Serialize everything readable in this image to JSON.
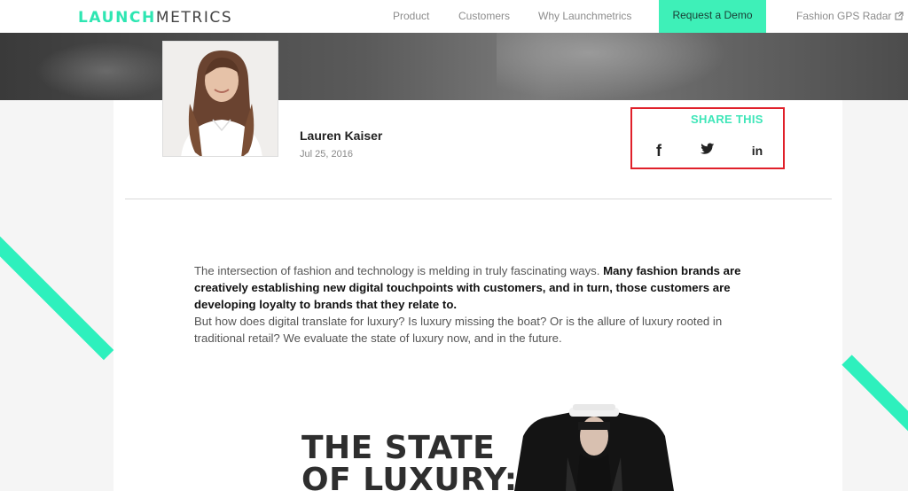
{
  "logo": {
    "text_main": "LAUNCH",
    "text_accent": "METRICS"
  },
  "nav": {
    "items": [
      {
        "label": "Product"
      },
      {
        "label": "Customers"
      },
      {
        "label": "Why Launchmetrics"
      }
    ],
    "demo_label": "Request a Demo",
    "radar_label": "Fashion GPS Radar"
  },
  "author": {
    "name": "Lauren Kaiser",
    "date": "Jul 25, 2016"
  },
  "share": {
    "title": "SHARE THIS",
    "buttons": [
      {
        "icon": "facebook-icon",
        "glyph": "f"
      },
      {
        "icon": "twitter-icon",
        "glyph": ""
      },
      {
        "icon": "linkedin-icon",
        "glyph": "in"
      }
    ]
  },
  "article": {
    "intro": "The intersection of fashion and technology is melding in truly fascinating ways. ",
    "intro_bold": "Many fashion brands are creatively establishing new digital touchpoints with customers, and in turn, those customers are developing loyalty to brands that they relate to.",
    "paragraph2": "But how does digital translate for luxury? Is luxury missing the boat? Or is the allure of luxury rooted in traditional retail? We evaluate the state of luxury now, and in the future."
  },
  "infographic": {
    "title_line1": "THE STATE",
    "title_line2": "OF LUXURY:"
  },
  "colors": {
    "accent": "#3ef0b8",
    "highlight_border": "#e0202a",
    "text": "#555555"
  }
}
